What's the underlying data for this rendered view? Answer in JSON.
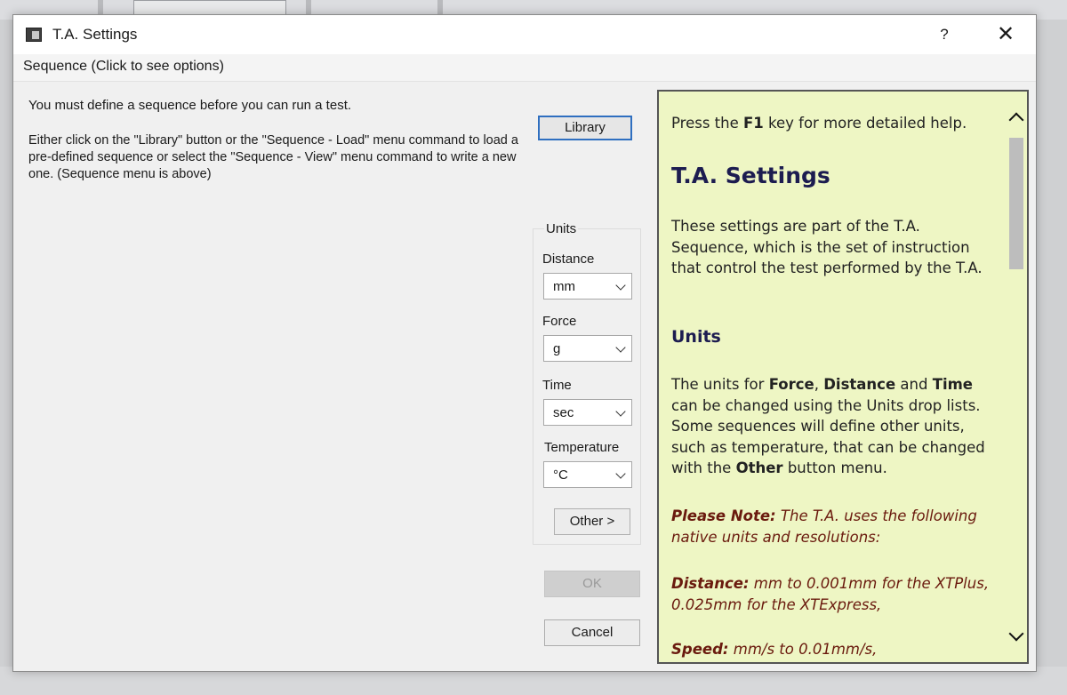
{
  "dialog": {
    "title": "T.A. Settings",
    "help_label": "?",
    "close_label": "✕"
  },
  "menu": {
    "sequence": "Sequence (Click to see options)"
  },
  "instructions": {
    "line1": "You must define a sequence before you can run a test.",
    "line2": "Either click on the \"Library\" button or the \"Sequence - Load\" menu command to load a pre-defined sequence or select the \"Sequence - View\" menu command to write a new one. (Sequence menu is above)"
  },
  "buttons": {
    "library": "Library",
    "other": "Other  >",
    "ok": "OK",
    "cancel": "Cancel"
  },
  "units": {
    "group_label": "Units",
    "distance_label": "Distance",
    "distance_value": "mm",
    "force_label": "Force",
    "force_value": "g",
    "time_label": "Time",
    "time_value": "sec",
    "temperature_label": "Temperature",
    "temperature_value": "°C"
  },
  "help": {
    "press_pre": "Press the ",
    "press_key": "F1",
    "press_post": " key for more detailed help.",
    "title": "T.A. Settings",
    "p1": "These settings are part of the T.A. Sequence, which is the set of instruction that control the test performed by the T.A.",
    "units_heading": "Units",
    "p2_a": "The units for ",
    "p2_force": "Force",
    "p2_b": ", ",
    "p2_distance": "Distance",
    "p2_c": " and ",
    "p2_time": "Time",
    "p2_d": " can be changed using the Units drop lists. Some sequences will define other units, such as temperature, that can be changed with the ",
    "p2_other": "Other",
    "p2_e": " button menu.",
    "note_label": "Please Note:",
    "note_text": " The T.A. uses the following native units and resolutions:",
    "distance_label": "Distance:",
    "distance_text": " mm to 0.001mm for the XTPlus, 0.025mm for the XTExpress,",
    "speed_label": "Speed:",
    "speed_text": " mm/s to 0.01mm/s,"
  },
  "colors": {
    "help_bg": "#eef6c4",
    "heading": "#1c1c50",
    "note": "#6a1a0e",
    "focus_border": "#2f6fc0"
  }
}
